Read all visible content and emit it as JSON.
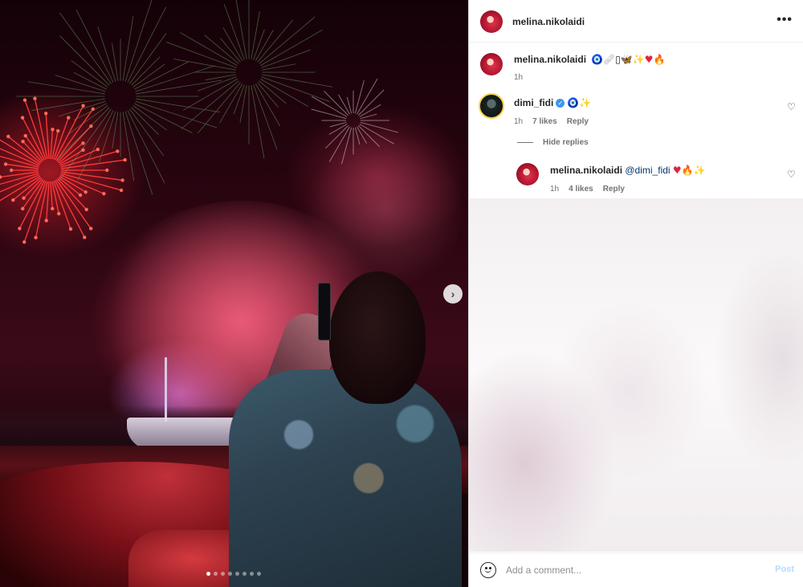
{
  "post": {
    "author": "melina.nikolaidi",
    "image_count": 8,
    "active_image_index": 0,
    "next_arrow": "›",
    "more_icon": "•••"
  },
  "caption": {
    "username": "melina.nikolaidi",
    "emojis": [
      "🧿",
      "🩹",
      "▯",
      "🦋",
      "✨",
      "♥",
      "🔥"
    ],
    "time": "1h"
  },
  "comments": [
    {
      "username": "dimi_fidi",
      "verified": true,
      "verified_mark": "✓",
      "emojis": [
        "🧿",
        "✨"
      ],
      "time": "1h",
      "likes": "7 likes",
      "reply_label": "Reply",
      "heart": "♡"
    }
  ],
  "hide_replies_label": "Hide replies",
  "replies": [
    {
      "username": "melina.nikolaidi",
      "mention": "@dimi_fidi",
      "emojis": [
        "♥",
        "🔥",
        "✨"
      ],
      "time": "1h",
      "likes": "4 likes",
      "reply_label": "Reply",
      "heart": "♡"
    }
  ],
  "comment_box": {
    "placeholder": "Add a comment...",
    "post_label": "Post"
  },
  "colors": {
    "link_blue": "#00376b",
    "post_disabled": "#b3dbff",
    "verified_blue": "#3897f0",
    "meta_gray": "#737373"
  }
}
